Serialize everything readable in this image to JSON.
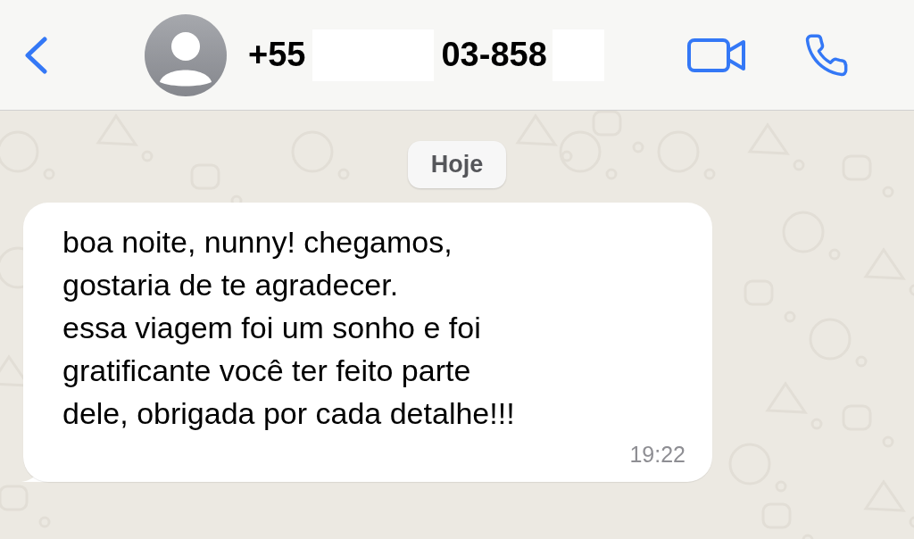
{
  "header": {
    "contact_number_parts": [
      "+55",
      "03-858"
    ]
  },
  "date_divider": "Hoje",
  "messages": [
    {
      "kind": "incoming",
      "text": "boa noite, nunny! chegamos,\ngostaria de te agradecer.\nessa viagem foi um sonho e foi\ngratificante você ter feito parte\ndele, obrigada por cada detalhe!!!",
      "time": "19:22"
    }
  ]
}
